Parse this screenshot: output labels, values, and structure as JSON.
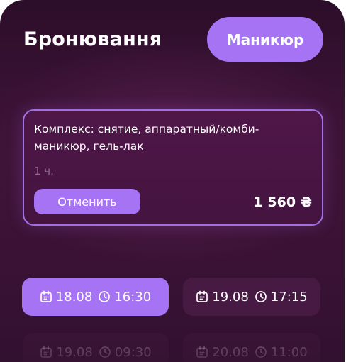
{
  "header": {
    "title": "Бронювання",
    "category_label": "Маникюр"
  },
  "booking": {
    "service": "Комплекс: снятие, аппаратный/комби-маникюр, гель-лак",
    "duration": "1 ч.",
    "cancel_label": "Отменить",
    "price": "1 560 ₴"
  },
  "slots": [
    {
      "date": "18.08",
      "time": "16:30",
      "state": "selected"
    },
    {
      "date": "19.08",
      "time": "17:15",
      "state": "available"
    },
    {
      "date": "19.08",
      "time": "09:30",
      "state": "dimmed"
    },
    {
      "date": "20.08",
      "time": "11:00",
      "state": "dimmed"
    }
  ],
  "colors": {
    "accent": "#a573f3",
    "background": "#3a1235",
    "card_border": "#a06fe6"
  },
  "icons": {
    "date": "calendar-icon",
    "time": "clock-icon"
  }
}
